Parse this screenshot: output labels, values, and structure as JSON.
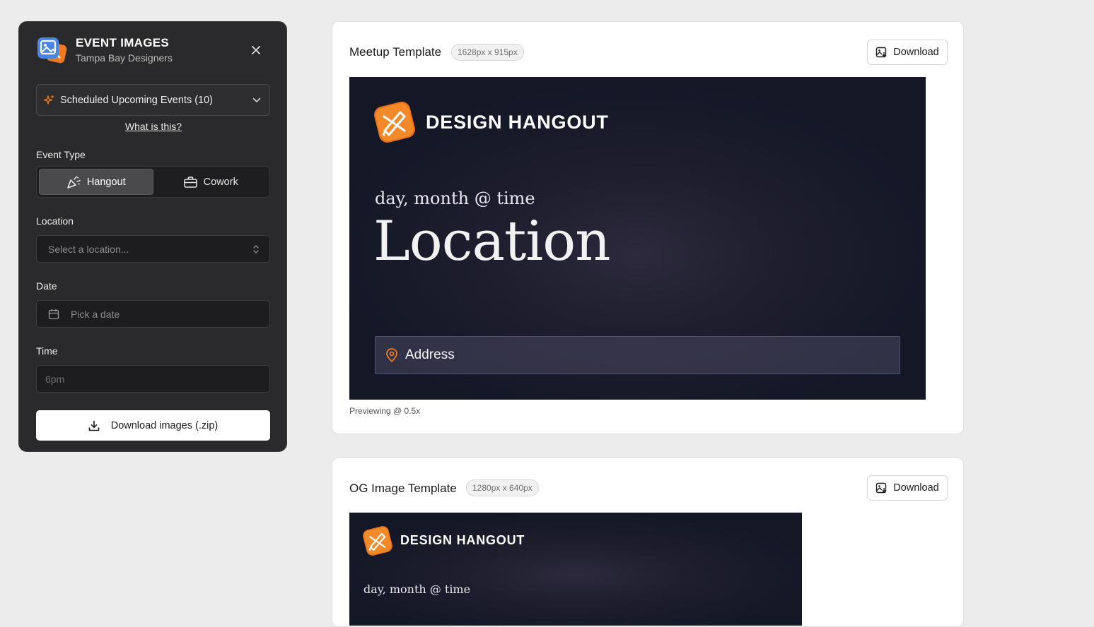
{
  "panel": {
    "app_title": "EVENT IMAGES",
    "app_subtitle": "Tampa Bay Designers",
    "close_icon": "close-icon",
    "events_select": {
      "label": "Scheduled Upcoming Events (10)",
      "icon": "sparkles-icon"
    },
    "what_link": "What is this?",
    "event_type": {
      "label": "Event Type",
      "options": [
        {
          "label": "Hangout",
          "icon": "party-popper-icon",
          "active": true
        },
        {
          "label": "Cowork",
          "icon": "briefcase-icon",
          "active": false
        }
      ]
    },
    "location": {
      "label": "Location",
      "placeholder": "Select a location..."
    },
    "date": {
      "label": "Date",
      "placeholder": "Pick a date"
    },
    "time": {
      "label": "Time",
      "placeholder": "6pm"
    },
    "download_zip": "Download images (.zip)"
  },
  "colors": {
    "brand_orange": "#f07a1e",
    "panel_bg": "#2a2a2c",
    "preview_bg": "#131726"
  },
  "cards": [
    {
      "title": "Meetup Template",
      "dimensions": "1628px x 915px",
      "download_label": "Download",
      "brand": "DESIGN HANGOUT",
      "when": "day, month @ time",
      "location": "Location",
      "address": "Address",
      "preview_note": "Previewing @ 0.5x"
    },
    {
      "title": "OG Image Template",
      "dimensions": "1280px x 640px",
      "download_label": "Download",
      "brand": "DESIGN HANGOUT",
      "when": "day, month @ time"
    }
  ]
}
